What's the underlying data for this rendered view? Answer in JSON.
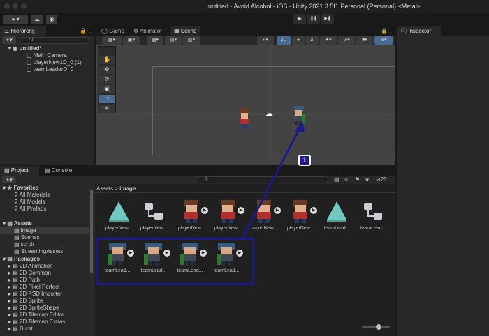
{
  "window": {
    "title": "untitled - Avoid Alcohol - iOS - Unity 2021.3.5f1 Personal (Personal) <Metal>"
  },
  "toolbar": {
    "account": "▾",
    "play": "▶",
    "pause": "❚❚",
    "step": "▶❚"
  },
  "hierarchy": {
    "tab": "Hierarchy",
    "search_placeholder": "All",
    "scene": "untitled*",
    "items": [
      "Main Camera",
      "playerNew1D_0 (1)",
      "teamLeaderD_0"
    ]
  },
  "scene_tabs": [
    "Game",
    "Animator",
    "Scene"
  ],
  "scene_toolbar": {
    "mode_2d": "2D"
  },
  "inspector": {
    "tab": "Inspector"
  },
  "annotation": {
    "badge": "1",
    "color": "#1a1a8c"
  },
  "project": {
    "tabs": [
      "Project",
      "Console"
    ],
    "count": "23",
    "breadcrumb": [
      "Assets",
      "image"
    ],
    "favorites_title": "Favorites",
    "favorites": [
      "All Materials",
      "All Models",
      "All Prefabs"
    ],
    "assets_title": "Assets",
    "assets_folders": [
      "image",
      "Scenes",
      "scrpit",
      "StreamingAssets"
    ],
    "packages_title": "Packages",
    "packages": [
      "2D Animation",
      "2D Common",
      "2D Path",
      "2D Pixel Perfect",
      "2D PSD Importer",
      "2D Sprite",
      "2D SpriteShape",
      "2D Tilemap Editor",
      "2D Tilemap Extras",
      "Burst"
    ],
    "grid_row1": [
      "playerNew...",
      "playerNew...",
      "playerNew...",
      "playerNew...",
      "playerNew...",
      "playerNew...",
      "teamLead...",
      "teamLead..."
    ],
    "grid_row2": [
      "teamLead...",
      "teamLead...",
      "teamLead...",
      "teamLead..."
    ]
  }
}
